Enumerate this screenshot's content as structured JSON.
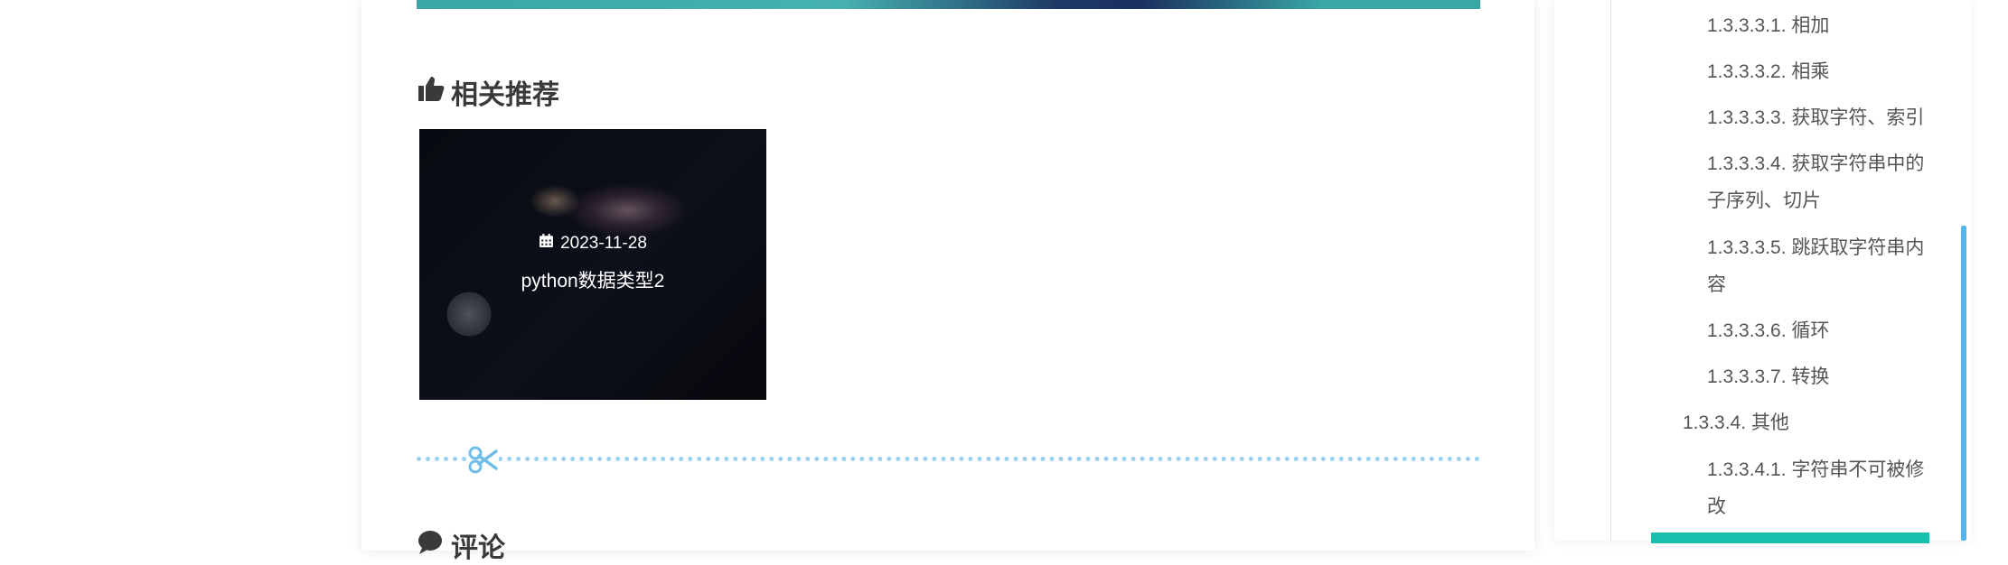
{
  "related": {
    "heading": "相关推荐",
    "items": [
      {
        "date": "2023-11-28",
        "title": "python数据类型2"
      }
    ]
  },
  "comments": {
    "heading": "评论"
  },
  "toc": {
    "items": [
      {
        "label": "1.3.3.3.1. 相加"
      },
      {
        "label": "1.3.3.3.2. 相乘"
      },
      {
        "label": "1.3.3.3.3. 获取字符、索引"
      },
      {
        "label": "1.3.3.3.4. 获取字符串中的",
        "label_cont": "子序列、切片"
      },
      {
        "label": "1.3.3.3.5. 跳跃取字符串内",
        "label_cont": "容"
      },
      {
        "label": "1.3.3.3.6. 循环"
      },
      {
        "label": "1.3.3.3.7. 转换"
      },
      {
        "label": "1.3.3.4. 其他"
      },
      {
        "label": "1.3.3.4.1. 字符串不可被修",
        "label_cont": "改"
      }
    ]
  },
  "colors": {
    "accent": "#52b6ec",
    "active": "#17bfae",
    "divider": "#9ad0f0"
  }
}
